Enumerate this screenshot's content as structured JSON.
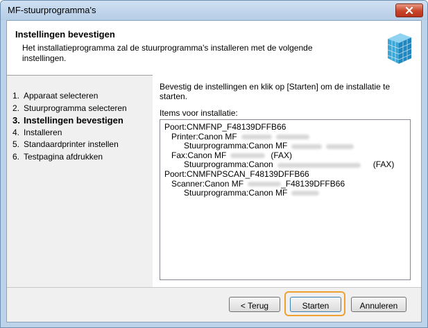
{
  "window": {
    "title": "MF-stuurprogramma's"
  },
  "header": {
    "title": "Instellingen bevestigen",
    "description": "Het installatieprogramma zal de stuurprogramma's installeren met de volgende instellingen."
  },
  "steps": [
    {
      "num": "1.",
      "label": "Apparaat selecteren",
      "active": false
    },
    {
      "num": "2.",
      "label": "Stuurprogramma selecteren",
      "active": false
    },
    {
      "num": "3.",
      "label": "Instellingen bevestigen",
      "active": true
    },
    {
      "num": "4.",
      "label": "Installeren",
      "active": false
    },
    {
      "num": "5.",
      "label": "Standaardprinter instellen",
      "active": false
    },
    {
      "num": "6.",
      "label": "Testpagina afdrukken",
      "active": false
    }
  ],
  "content": {
    "instruction": "Bevestig de instellingen en klik op [Starten] om de installatie te starten.",
    "items_label": "Items voor installatie:",
    "items": [
      {
        "level": 0,
        "text": "Poort:CNMFNP_F48139DFFB66",
        "suffix": ""
      },
      {
        "level": 1,
        "text": "Printer:Canon MF",
        "suffix": ""
      },
      {
        "level": 2,
        "text": "Stuurprogramma:Canon MF",
        "suffix": ""
      },
      {
        "level": 1,
        "text": "Fax:Canon MF",
        "suffix": "(FAX)"
      },
      {
        "level": 2,
        "text": "Stuurprogramma:Canon",
        "suffix": "(FAX)"
      },
      {
        "level": 0,
        "text": "Poort:CNMFNPSCAN_F48139DFFB66",
        "suffix": ""
      },
      {
        "level": 1,
        "text": "Scanner:Canon MF",
        "suffix": "_F48139DFFB66"
      },
      {
        "level": 2,
        "text": "Stuurprogramma:Canon MF",
        "suffix": ""
      }
    ]
  },
  "buttons": {
    "back": "< Terug",
    "start": "Starten",
    "cancel": "Annuleren"
  },
  "colors": {
    "highlight": "#f0a030",
    "close_button": "#c8452a"
  },
  "icons": {
    "close": "close-icon",
    "logo": "canon-mf-package-icon"
  }
}
